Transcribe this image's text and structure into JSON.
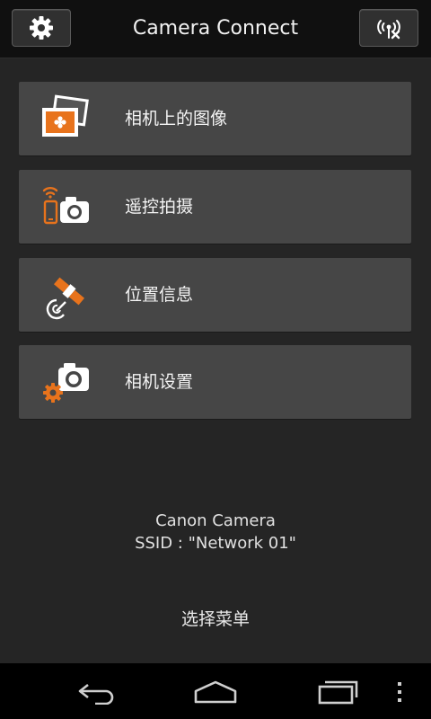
{
  "header": {
    "title": "Camera Connect",
    "settings_icon": "gear-icon",
    "connection_icon": "wireless-disconnect-icon"
  },
  "menu": {
    "items": [
      {
        "label": "相机上的图像",
        "icon": "camera-images-icon"
      },
      {
        "label": "遥控拍摄",
        "icon": "remote-shooting-icon"
      },
      {
        "label": "位置信息",
        "icon": "satellite-location-icon"
      },
      {
        "label": "相机设置",
        "icon": "camera-settings-icon"
      }
    ]
  },
  "camera_info": {
    "name": "Canon Camera",
    "ssid": "SSID : \"Network 01\""
  },
  "footer": {
    "label": "选择菜单"
  },
  "navbar": {
    "back_icon": "back-icon",
    "home_icon": "home-icon",
    "recents_icon": "recent-apps-icon",
    "overflow_icon": "overflow-menu-icon"
  },
  "colors": {
    "accent_orange": "#e8731c",
    "item_bg": "#464646",
    "screen_bg": "#252525"
  }
}
